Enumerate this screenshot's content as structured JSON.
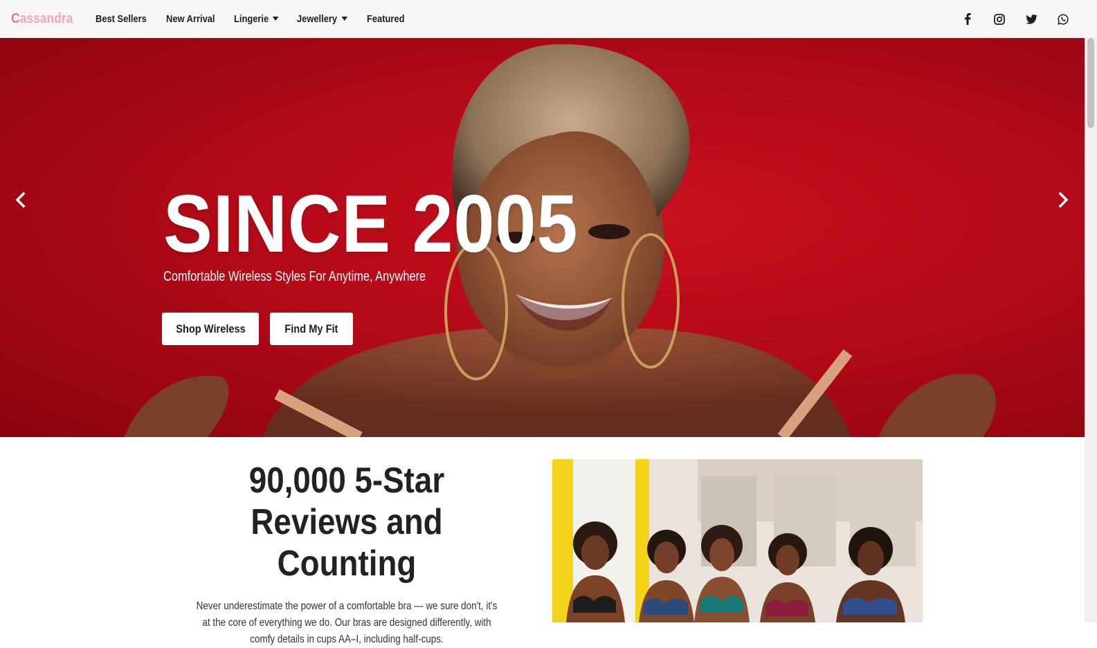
{
  "navbar": {
    "brand_first": "C",
    "brand_rest": "assandra",
    "items": [
      {
        "label": "Best Sellers",
        "dropdown": false
      },
      {
        "label": "New Arrival",
        "dropdown": false
      },
      {
        "label": "Lingerie",
        "dropdown": true
      },
      {
        "label": "Jewellery",
        "dropdown": true
      },
      {
        "label": "Featured",
        "dropdown": false
      }
    ],
    "social_icons": [
      "facebook-icon",
      "instagram-icon",
      "twitter-icon",
      "whatsapp-icon"
    ]
  },
  "hero": {
    "title": "SINCE 2005",
    "subtitle": "Comfortable Wireless Styles For Anytime, Anywhere",
    "buttons": {
      "shop": "Shop Wireless",
      "fit": "Find My Fit"
    },
    "background_color": "#b30a18"
  },
  "reviews": {
    "title_line1": "90,000 5-Star",
    "title_line2": "Reviews and Counting",
    "body": "Never underestimate the power of a comfortable bra — we sure don't, it's at the core of everything we do. Our bras are designed differently, with comfy details in cups AA–I, including half-cups."
  },
  "colors": {
    "brand": "#f2a7b0",
    "brand_first": "#e07b88",
    "hero_red": "#b30a18",
    "text_dark": "#222222"
  }
}
